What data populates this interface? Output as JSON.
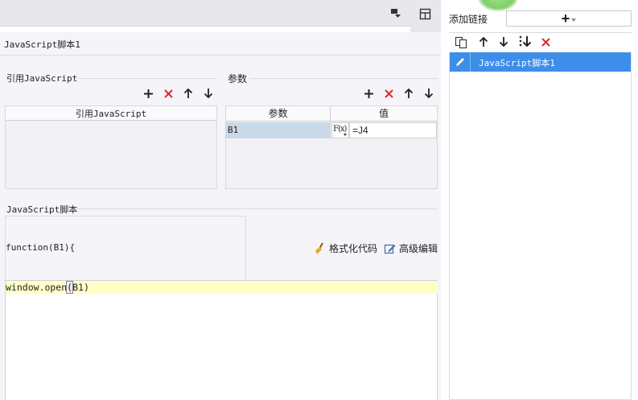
{
  "window": {
    "script_tab_title": "JavaScript脚本1"
  },
  "ref_section": {
    "title": "引用JavaScript",
    "column_header": "引用JavaScript"
  },
  "params_section": {
    "title": "参数",
    "col_param": "参数",
    "col_value": "值",
    "rows": [
      {
        "param": "B1",
        "formula_icon": "F(x)",
        "value": "=J4"
      }
    ]
  },
  "script_section": {
    "title": "JavaScript脚本",
    "function_signature": "function(B1){",
    "format_code_label": "格式化代码",
    "advanced_edit_label": "高级编辑",
    "code_line_1_a": "window.open",
    "code_line_1_paren": "(",
    "code_line_1_b": "B1)"
  },
  "right_panel": {
    "add_link_label": "添加链接",
    "add_symbol": "+",
    "list_items": [
      "JavaScript脚本1"
    ]
  },
  "colors": {
    "selection_blue": "#3d8ee9",
    "delete_red": "#d92b2b",
    "code_highlight": "#ffffc8",
    "param_cell_bg": "#c9d9e8"
  }
}
